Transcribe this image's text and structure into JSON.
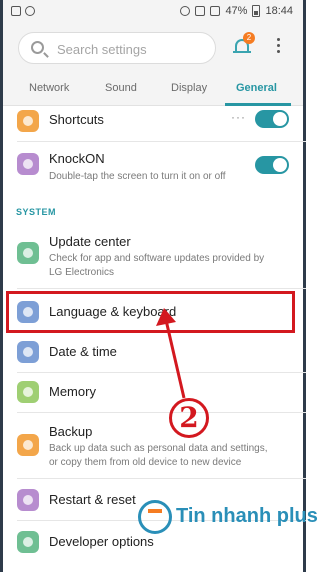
{
  "status_bar": {
    "battery": "47%",
    "time": "18:44"
  },
  "header": {
    "search_placeholder": "Search settings",
    "notification_count": "2"
  },
  "tabs": [
    {
      "label": "Network"
    },
    {
      "label": "Sound"
    },
    {
      "label": "Display"
    },
    {
      "label": "General",
      "active": true
    }
  ],
  "items": {
    "shortcuts": {
      "title": "Shortcuts",
      "toggle_on": true
    },
    "knockon": {
      "title": "KnockON",
      "subtitle": "Double-tap the screen to turn it on or off",
      "toggle_on": true
    },
    "section_system": "SYSTEM",
    "update_center": {
      "title": "Update center",
      "subtitle": "Check for app and software updates provided by LG Electronics"
    },
    "language": {
      "title": "Language & keyboard"
    },
    "date_time": {
      "title": "Date & time"
    },
    "memory": {
      "title": "Memory"
    },
    "backup": {
      "title": "Backup",
      "subtitle": "Back up data such as personal data and settings, or copy them from old device to new device"
    },
    "restart": {
      "title": "Restart & reset"
    },
    "developer": {
      "title": "Developer options"
    }
  },
  "annotation": {
    "step_number": "2"
  },
  "watermark": {
    "text": "Tin nhanh plus"
  },
  "colors": {
    "accent": "#2796a3",
    "highlight": "#d3181f",
    "badge": "#f57c22"
  },
  "icons": [
    "alarm-icon",
    "wifi-icon",
    "signal-icon",
    "battery-icon",
    "search-icon",
    "bell-icon",
    "more-icon"
  ]
}
